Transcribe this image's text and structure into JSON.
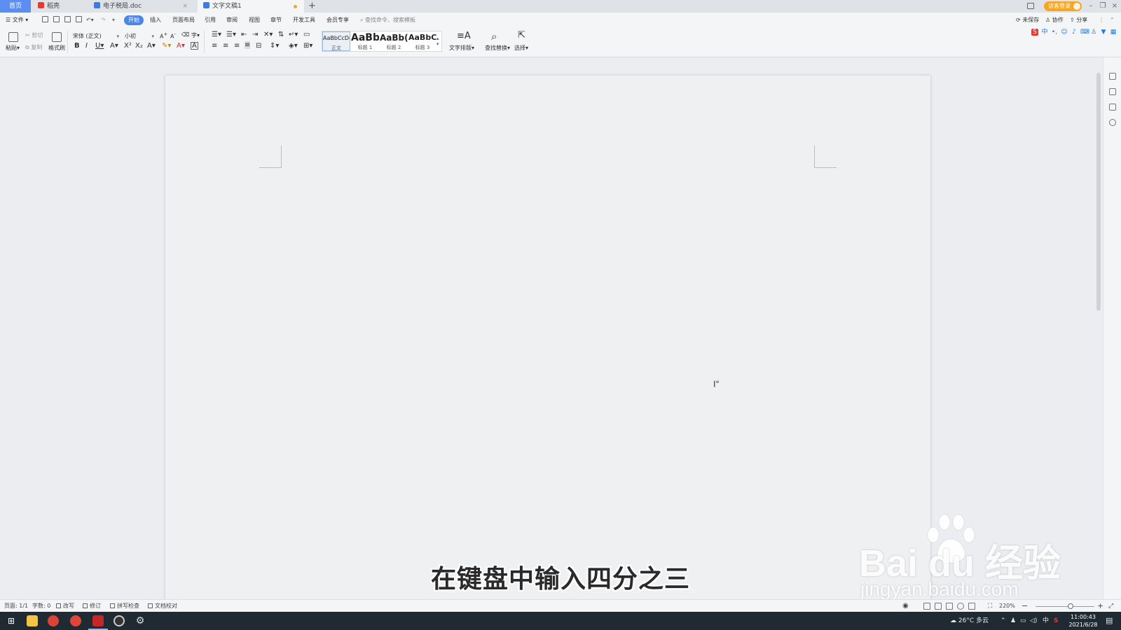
{
  "tabs": [
    {
      "label": "首页"
    },
    {
      "label": "稻壳"
    },
    {
      "label": "电子税局.doc"
    },
    {
      "label": "文字文稿1"
    }
  ],
  "titlebar": {
    "login_label": "访客登录"
  },
  "menu": {
    "file": "文件",
    "items": [
      "开始",
      "插入",
      "页面布局",
      "引用",
      "审阅",
      "视图",
      "章节",
      "开发工具",
      "会员专享"
    ],
    "search_placeholder": "查找命令、搜索模板",
    "unsaved": "未保存",
    "collab": "协作",
    "share": "分享"
  },
  "ribbon": {
    "paste": "粘贴",
    "cut": "剪切",
    "copy": "复制",
    "format_painter": "格式刷",
    "font_name": "宋体 (正文)",
    "font_size": "小初",
    "styles": [
      {
        "preview": "AaBbCcDd",
        "label": "正文"
      },
      {
        "preview": "AaBb",
        "label": "标题 1"
      },
      {
        "preview": "AaBb(",
        "label": "标题 2"
      },
      {
        "preview": "AaBbC(",
        "label": "标题 3"
      }
    ],
    "text_layout": "文字排版",
    "find_replace": "查找替换",
    "select": "选择"
  },
  "document": {
    "subtitle": "在键盘中输入四分之三"
  },
  "watermark": {
    "text": "Bai du 经验",
    "url": "jingyan.baidu.com"
  },
  "statusbar": {
    "page": "页面: 1/1",
    "words": "字数: 0",
    "overwrite": "改写",
    "revise": "修订",
    "spellcheck": "拼写检查",
    "proofread": "文档校对",
    "zoom": "220%"
  },
  "taskbar": {
    "weather": "26°C 多云",
    "ime": "中",
    "time": "11:00:43",
    "date": "2021/6/28"
  },
  "colors": {
    "accent": "#4a86e8",
    "login": "#f6a623",
    "taskbar": "#1f2a33"
  }
}
